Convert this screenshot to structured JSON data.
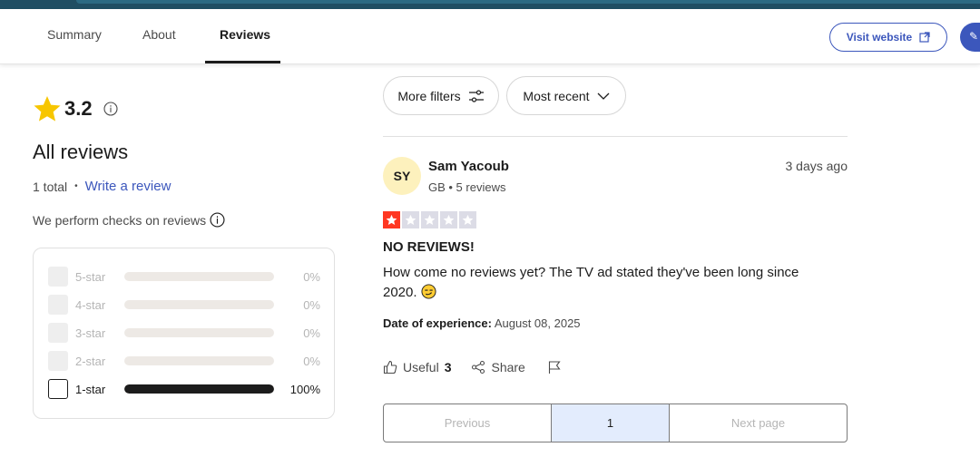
{
  "nav": {
    "tabs": [
      {
        "label": "Summary"
      },
      {
        "label": "About"
      },
      {
        "label": "Reviews"
      }
    ],
    "active_tab": "Reviews",
    "visit_website_label": "Visit website"
  },
  "summary": {
    "rating": "3.2",
    "heading": "All reviews",
    "total": "1 total",
    "write_review": "Write a review",
    "checks_text": "We perform checks on reviews"
  },
  "distribution": [
    {
      "label": "5-star",
      "percent": "0%",
      "value": 0
    },
    {
      "label": "4-star",
      "percent": "0%",
      "value": 0
    },
    {
      "label": "3-star",
      "percent": "0%",
      "value": 0
    },
    {
      "label": "2-star",
      "percent": "0%",
      "value": 0
    },
    {
      "label": "1-star",
      "percent": "100%",
      "value": 100
    }
  ],
  "filters": {
    "more_filters": "More filters",
    "sort": "Most recent"
  },
  "review": {
    "initials": "SY",
    "name": "Sam Yacoub",
    "meta": "GB • 5 reviews",
    "date": "3 days ago",
    "stars": 1,
    "title": "NO REVIEWS!",
    "body": "How come no reviews yet? The TV ad stated they've been long since 2020.",
    "experience_label": "Date of experience:",
    "experience_date": "August 08, 2025",
    "useful_label": "Useful",
    "useful_count": "3",
    "share_label": "Share"
  },
  "pagination": {
    "previous": "Previous",
    "current": "1",
    "next": "Next page"
  },
  "colors": {
    "accent": "#3c57bc",
    "star_gold": "#f7c600",
    "star_red": "#ff3722"
  },
  "icons": [
    "star-icon",
    "info-icon",
    "external-link-icon",
    "filter-icon",
    "chevron-down-icon",
    "thumbs-up-icon",
    "share-icon",
    "flag-icon"
  ]
}
